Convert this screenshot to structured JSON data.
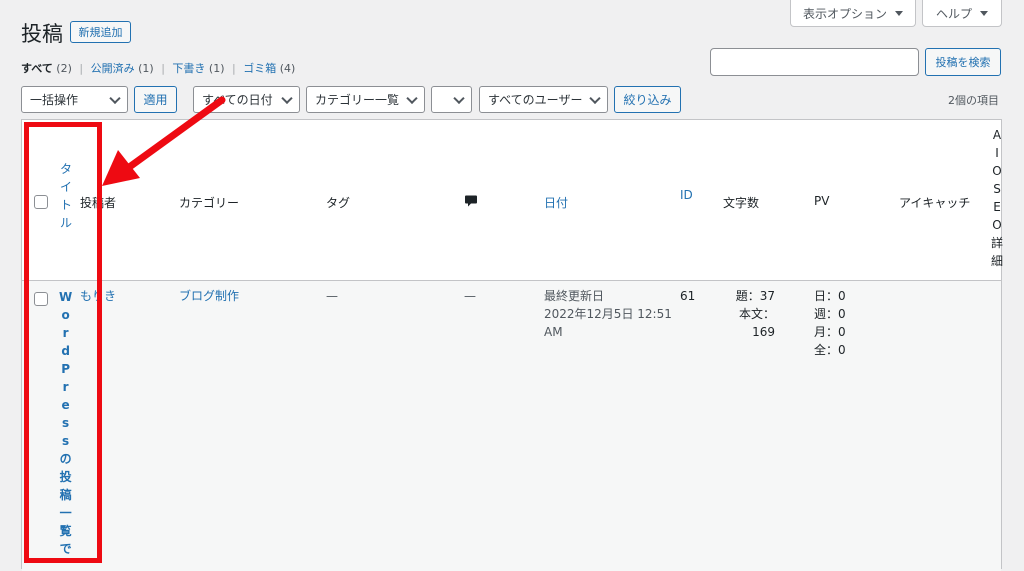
{
  "screen_options": {
    "label": "表示オプション"
  },
  "help": {
    "label": "ヘルプ"
  },
  "page_title": "投稿",
  "add_new": "新規追加",
  "filters": [
    {
      "label": "すべて",
      "count": "(2)",
      "current": true
    },
    {
      "label": "公開済み",
      "count": "(1)",
      "current": false
    },
    {
      "label": "下書き",
      "count": "(1)",
      "current": false
    },
    {
      "label": "ゴミ箱",
      "count": "(4)",
      "current": false
    }
  ],
  "filter_sep": "|",
  "search": {
    "value": "",
    "placeholder": "",
    "button": "投稿を検索"
  },
  "bulk": {
    "selected": "一括操作",
    "apply": "適用"
  },
  "dates": {
    "selected": "すべての日付"
  },
  "category": {
    "selected": "カテゴリー一覧"
  },
  "extra": {
    "selected": ""
  },
  "users": {
    "selected": "すべてのユーザー"
  },
  "filter_button": "絞り込み",
  "items_count": "2個の項目",
  "columns": {
    "title": [
      "タ",
      "イ",
      "ト",
      "ル"
    ],
    "author": "投稿者",
    "category": "カテゴリー",
    "tags": "タグ",
    "date": "日付",
    "id": "ID",
    "chars": "文字数",
    "pv": "PV",
    "thumbnail": "アイキャッチ",
    "aioseo": [
      "A",
      "I",
      "O",
      "S",
      "E",
      "O",
      "詳",
      "細"
    ]
  },
  "row": {
    "title_chars": [
      "W",
      "o",
      "r",
      "d",
      "P",
      "r",
      "e",
      "s",
      "s",
      "の",
      "投",
      "稿",
      "一",
      "覧",
      "で"
    ],
    "author": "もりき",
    "category": "ブログ制作",
    "tags": "—",
    "comments": "—",
    "date_status": "最終更新日",
    "date_value": "2022年12月5日 12:51",
    "date_ampm": "AM",
    "id": "61",
    "chars": [
      "題：37",
      "本文：169"
    ],
    "pv": [
      "日：0",
      "週：0",
      "月：0",
      "全：0"
    ]
  },
  "colors": {
    "accent": "#2271b1",
    "annotation": "#ee0a12"
  }
}
